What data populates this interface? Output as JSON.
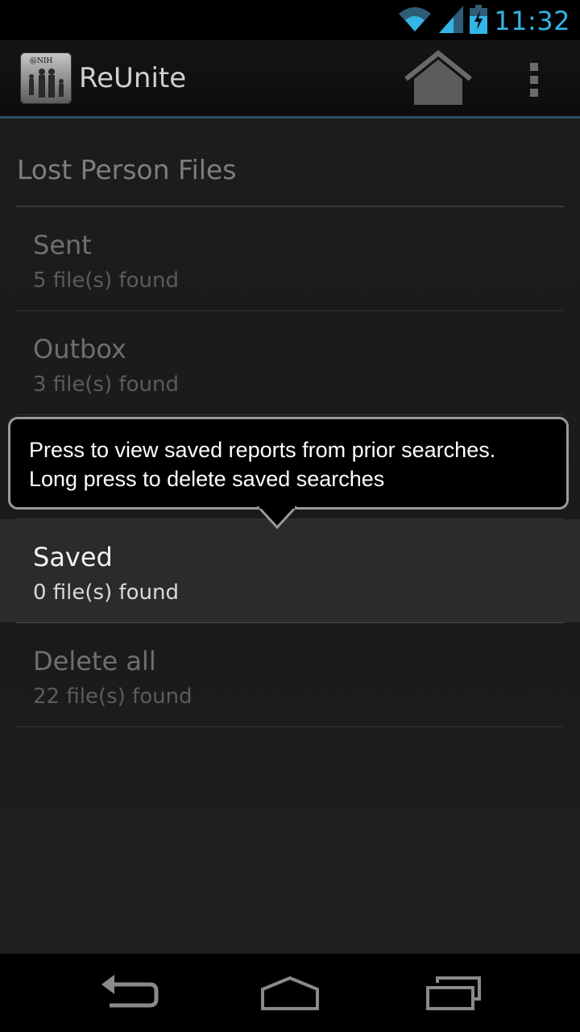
{
  "status_bar": {
    "time": "11:32",
    "icons": [
      "wifi-icon",
      "signal-icon",
      "battery-charging-icon"
    ],
    "clock_color": "#33b5e5"
  },
  "action_bar": {
    "app_name": "ReUnite",
    "app_icon_text": "@NIH",
    "home_icon": "home-icon",
    "overflow_icon": "overflow-menu-icon"
  },
  "section": {
    "title": "Lost Person Files"
  },
  "items": [
    {
      "title": "Sent",
      "subtitle": "5 file(s) found"
    },
    {
      "title": "Outbox",
      "subtitle": "3 file(s) found"
    },
    {
      "title": "",
      "subtitle": ""
    },
    {
      "title": "Saved",
      "subtitle": "0 file(s) found"
    },
    {
      "title": "Delete all",
      "subtitle": "22 file(s) found"
    }
  ],
  "tooltip": {
    "line1": "Press to view saved reports from prior searches.",
    "line2": "Long press to delete saved searches"
  },
  "nav_bar": {
    "icons": [
      "back-icon",
      "home-nav-icon",
      "recents-icon"
    ]
  },
  "colors": {
    "accent": "#33b5e5",
    "action_bar_divider": "#2a4e62"
  }
}
